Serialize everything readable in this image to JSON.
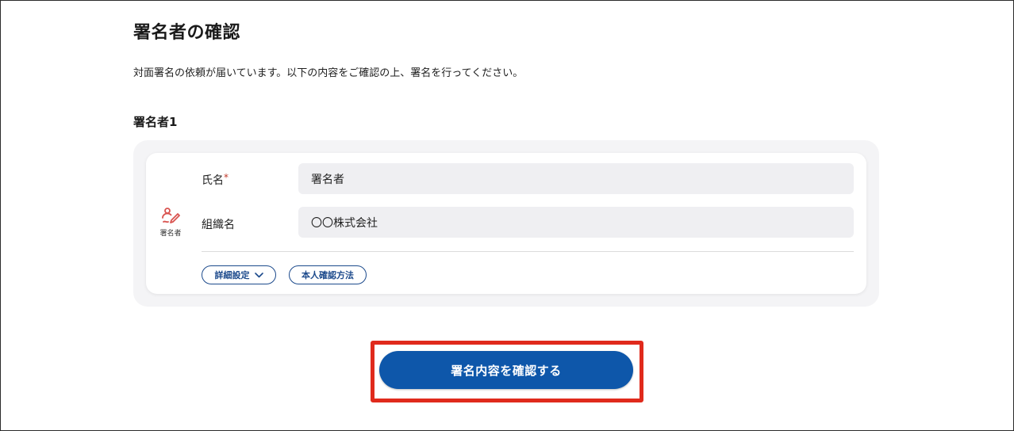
{
  "page": {
    "title": "署名者の確認",
    "intro": "対面署名の依頼が届いています。以下の内容をご確認の上、署名を行ってください。"
  },
  "signer": {
    "section_title": "署名者1",
    "role_label": "署名者",
    "role_icon": "signer-icon",
    "fields": [
      {
        "label": "氏名",
        "required_mark": "*",
        "value": "署名者"
      },
      {
        "label": "組織名",
        "value": "〇〇株式会社"
      }
    ],
    "buttons": {
      "details": "詳細設定",
      "details_icon": "chevron-down-icon",
      "verification": "本人確認方法"
    }
  },
  "actions": {
    "confirm": "署名内容を確認する"
  },
  "colors": {
    "primary": "#0e57aa",
    "outline": "#1c4a8c",
    "highlight": "#e02a1c",
    "required": "#c0392b",
    "role_icon": "#d9534f"
  }
}
